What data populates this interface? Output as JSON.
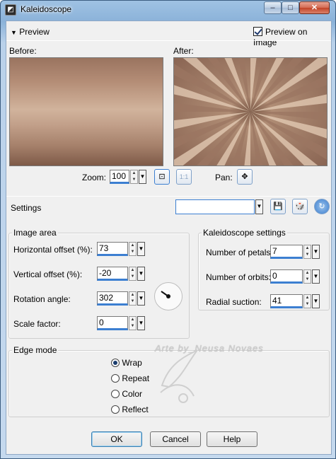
{
  "window": {
    "title": "Kaleidoscope",
    "icon": "kaleidoscope-app-icon"
  },
  "titlebar_buttons": {
    "minimize": "–",
    "maximize": "□",
    "close": "✕"
  },
  "preview": {
    "toggle_label": "Preview",
    "preview_on_image_label": "Preview on Image",
    "preview_on_image_checked": true
  },
  "panels": {
    "before_label": "Before:",
    "after_label": "After:"
  },
  "zoom": {
    "label": "Zoom:",
    "value": "100",
    "fit_icon": "fit-icon",
    "actual_size_label": "1:1"
  },
  "pan": {
    "label": "Pan:",
    "icon": "pan-move-icon"
  },
  "settings": {
    "label": "Settings",
    "preset_value": "",
    "icons": [
      "save-preset-icon",
      "randomize-icon",
      "reset-icon"
    ]
  },
  "image_area": {
    "title": "Image area",
    "fields": [
      {
        "label": "Horizontal offset (%):",
        "value": "73",
        "fill": 0.86
      },
      {
        "label": "Vertical offset (%):",
        "value": "-20",
        "fill": 0.4
      },
      {
        "label": "Rotation angle:",
        "value": "302",
        "fill": 0.84
      },
      {
        "label": "Scale factor:",
        "value": "0",
        "fill": 0.5
      }
    ]
  },
  "kaleidoscope_settings": {
    "title": "Kaleidoscope settings",
    "fields": [
      {
        "label": "Number of petals:",
        "value": "7",
        "fill": 0.1
      },
      {
        "label": "Number of orbits:",
        "value": "0",
        "fill": 0.0
      },
      {
        "label": "Radial suction:",
        "value": "41",
        "fill": 0.5
      }
    ]
  },
  "edge_mode": {
    "title": "Edge mode",
    "options": [
      "Wrap",
      "Repeat",
      "Color",
      "Reflect"
    ],
    "selected": "Wrap"
  },
  "watermark": "Arte by_Neusa Novaes",
  "buttons": {
    "ok": "OK",
    "cancel": "Cancel",
    "help": "Help"
  },
  "colors": {
    "accent": "#3c7fd1",
    "preview_brown": "#a5806a"
  }
}
